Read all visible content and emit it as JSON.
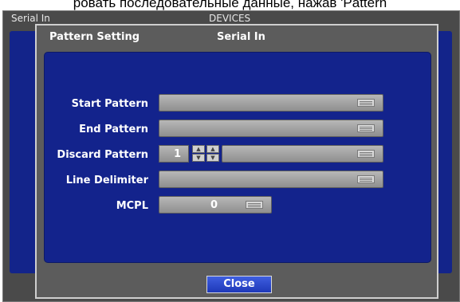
{
  "caption": "ровать последовательные данные, нажав 'Pattern",
  "background_window": {
    "left_title": "Serial In",
    "center_title": "DEVICES"
  },
  "dialog": {
    "title_left": "Pattern Setting",
    "title_center": "Serial In",
    "rows": {
      "start_pattern": {
        "label": "Start Pattern",
        "value": ""
      },
      "end_pattern": {
        "label": "End Pattern",
        "value": ""
      },
      "discard_pattern": {
        "label": "Discard Pattern",
        "count": "1",
        "value": ""
      },
      "line_delimiter": {
        "label": "Line Delimiter",
        "value": ""
      },
      "mcpl": {
        "label": "MCPL",
        "value": "0"
      }
    },
    "close_label": "Close"
  },
  "icons": {
    "keyboard": "keyboard-icon",
    "spin_up": "arrow-up-icon",
    "spin_down": "arrow-down-icon"
  },
  "colors": {
    "panel_blue": "#13238c",
    "dialog_gray": "#5c5c5c",
    "button_blue": "#2a46cc"
  }
}
